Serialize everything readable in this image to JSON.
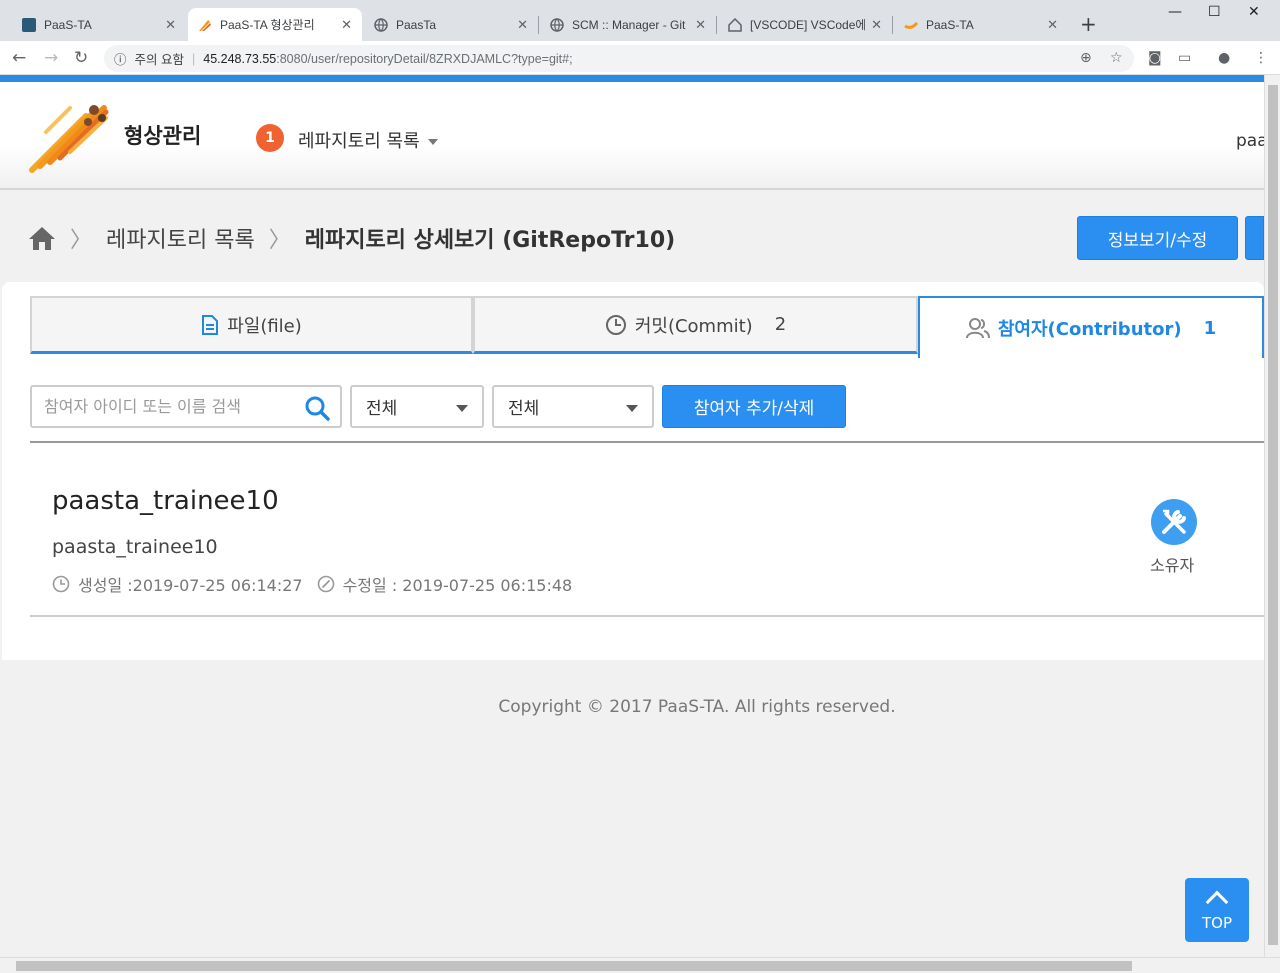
{
  "browser": {
    "tabs": [
      {
        "label": "PaaS-TA",
        "icon": "app-icon"
      },
      {
        "label": "PaaS-TA 형상관리",
        "icon": "scm-logo-icon"
      },
      {
        "label": "PaasTa",
        "icon": "globe-icon"
      },
      {
        "label": "SCM :: Manager - Git",
        "icon": "globe-icon"
      },
      {
        "label": "[VSCODE] VSCode에 (",
        "icon": "house-icon"
      },
      {
        "label": "PaaS-TA",
        "icon": "swoosh-icon"
      }
    ],
    "active_tab": 1,
    "security_label": "주의 요함",
    "url_host": "45.248.73.55",
    "url_path": ":8080/user/repositoryDetail/8ZRXDJAMLC?type=git#;"
  },
  "header": {
    "app_title": "형상관리",
    "badge_count": "1",
    "repo_menu_label": "레파지토리 목록",
    "user_label": "paa"
  },
  "breadcrumb": {
    "level1": "레파지토리 목록",
    "current": "레파지토리 상세보기 (GitRepoTr10)"
  },
  "actions": {
    "info_edit": "정보보기/수정"
  },
  "content_tabs": [
    {
      "label": "파일(file)",
      "count": "",
      "icon": "file-icon"
    },
    {
      "label": "커밋(Commit)",
      "count": "2",
      "icon": "clock-icon"
    },
    {
      "label": "참여자(Contributor)",
      "count": "1",
      "icon": "users-icon"
    }
  ],
  "filters": {
    "search_placeholder": "참여자 아이디 또는 이름 검색",
    "select1_value": "전체",
    "select2_value": "전체",
    "add_remove_label": "참여자 추가/삭제"
  },
  "member": {
    "name": "paasta_trainee10",
    "id": "paasta_trainee10",
    "created": "생성일 :2019-07-25 06:14:27",
    "modified": "수정일 : 2019-07-25 06:15:48",
    "role": "소유자"
  },
  "footer": {
    "copyright": "Copyright © 2017 PaaS-TA. All rights reserved."
  },
  "top_button": "TOP",
  "colors": {
    "accent": "#2a8ff0",
    "badge": "#f0622f",
    "header_bar": "#2b8be2"
  }
}
